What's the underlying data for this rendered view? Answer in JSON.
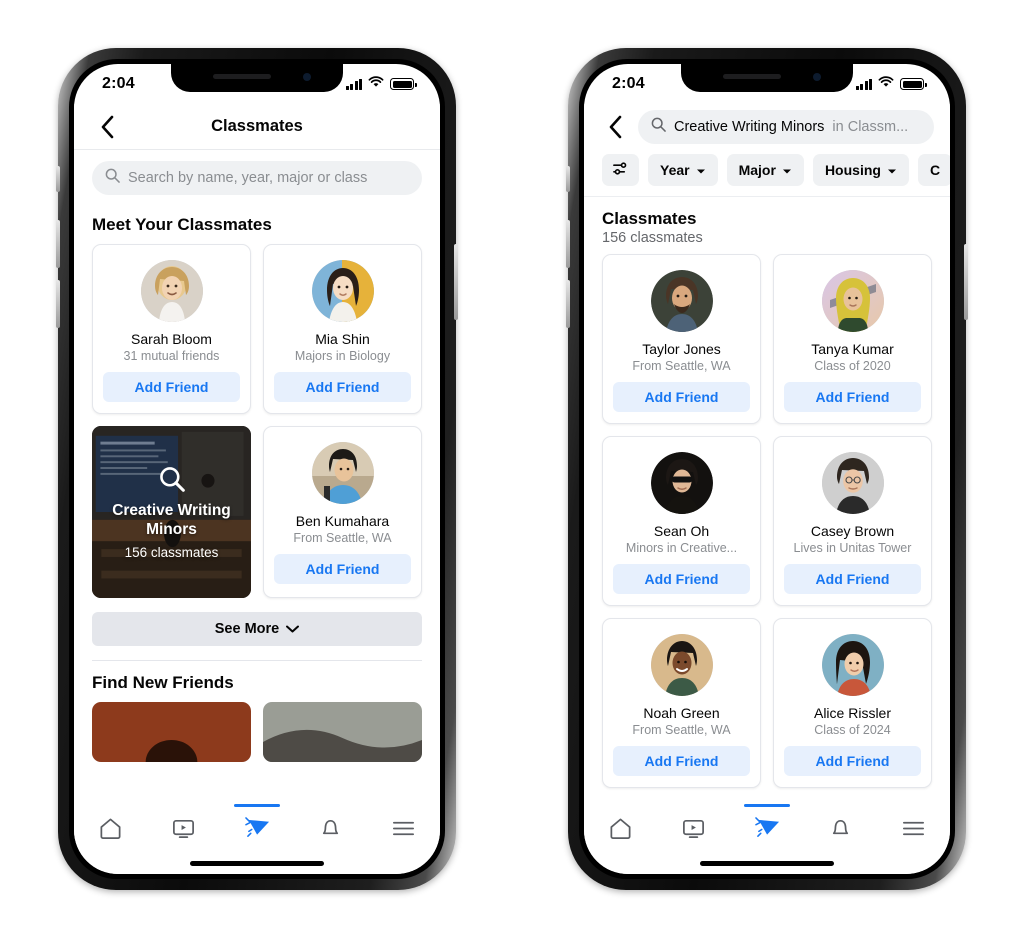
{
  "status_bar": {
    "time": "2:04",
    "cellular": "signal-bars-icon",
    "wifi": "wifi-icon",
    "battery": "battery-full-icon"
  },
  "colors": {
    "accent": "#1877F2",
    "chip_bg": "#EFF1F3",
    "btn_bg": "#E7F0FD",
    "muted": "#8A8D91",
    "text": "#050505"
  },
  "phone_left": {
    "nav": {
      "back_icon": "chevron-left-icon",
      "title": "Classmates"
    },
    "search": {
      "placeholder": "Search by name, year, major or class",
      "icon": "search-icon"
    },
    "section_title": "Meet Your Classmates",
    "cards": [
      {
        "type": "person",
        "name": "Sarah Bloom",
        "subtitle": "31 mutual friends",
        "action": "Add Friend",
        "avatar": "avatar-sarah-bloom"
      },
      {
        "type": "person",
        "name": "Mia Shin",
        "subtitle": "Majors in Biology",
        "action": "Add Friend",
        "avatar": "avatar-mia-shin"
      },
      {
        "type": "group",
        "title": "Creative Writing Minors",
        "count": "156 classmates",
        "icon": "magnifier-icon"
      },
      {
        "type": "person",
        "name": "Ben Kumahara",
        "subtitle": "From Seattle, WA",
        "action": "Add Friend",
        "avatar": "avatar-ben-kumahara"
      }
    ],
    "see_more": {
      "label": "See More",
      "icon": "chevron-down-icon"
    },
    "find_friends_title": "Find New Friends"
  },
  "phone_right": {
    "nav": {
      "back_icon": "chevron-left-icon",
      "search_icon": "search-icon",
      "query": "Creative Writing Minors",
      "scope": "in Classm..."
    },
    "filters": [
      {
        "label": "",
        "icon": "tune-sliders-icon"
      },
      {
        "label": "Year",
        "icon": "chevron-down-icon"
      },
      {
        "label": "Major",
        "icon": "chevron-down-icon"
      },
      {
        "label": "Housing",
        "icon": "chevron-down-icon"
      },
      {
        "label": "C",
        "icon": "chevron-down-icon"
      }
    ],
    "results": {
      "title": "Classmates",
      "count": "156 classmates"
    },
    "cards": [
      {
        "name": "Taylor Jones",
        "subtitle": "From Seattle, WA",
        "action": "Add Friend",
        "avatar": "avatar-taylor-jones"
      },
      {
        "name": "Tanya Kumar",
        "subtitle": "Class of 2020",
        "action": "Add Friend",
        "avatar": "avatar-tanya-kumar"
      },
      {
        "name": "Sean Oh",
        "subtitle": "Minors in Creative...",
        "action": "Add Friend",
        "avatar": "avatar-sean-oh"
      },
      {
        "name": "Casey Brown",
        "subtitle": "Lives in Unitas Tower",
        "action": "Add Friend",
        "avatar": "avatar-casey-brown"
      },
      {
        "name": "Noah Green",
        "subtitle": "From Seattle, WA",
        "action": "Add Friend",
        "avatar": "avatar-noah-green"
      },
      {
        "name": "Alice Rissler",
        "subtitle": "Class of 2024",
        "action": "Add Friend",
        "avatar": "avatar-alice-rissler"
      }
    ]
  },
  "tabbar": {
    "items": [
      {
        "name": "home-icon",
        "active": false
      },
      {
        "name": "watch-video-icon",
        "active": false
      },
      {
        "name": "campus-pennant-icon",
        "active": true
      },
      {
        "name": "bell-notifications-icon",
        "active": false
      },
      {
        "name": "menu-hamburger-icon",
        "active": false
      }
    ]
  }
}
